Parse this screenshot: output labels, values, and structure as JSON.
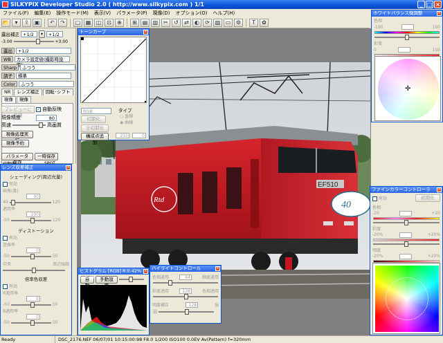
{
  "window": {
    "title": "SILKYPIX Developer Studio 2.0 ( http://www.silkypix.com )  1/1"
  },
  "menu": [
    "ファイル(F)",
    "編集(E)",
    "操作モード(M)",
    "表示(V)",
    "パラメータ(P)",
    "現像(D)",
    "オプション(O)",
    "ヘルプ(H)"
  ],
  "left": {
    "exposure_label": "露出補正",
    "exposure_value": "+1/2",
    "exposure_value2": "+1/2",
    "range_min": "-3.00",
    "range_max": "+3.00",
    "exposure_sel_label": "露出",
    "exposure_sel": "+1/2",
    "wb_label": "WB",
    "wb_value": "カメラ設定値(撮影時設定)",
    "sharp_label": "Sharp",
    "sharp_value": "ふつう",
    "tone_label": "調子",
    "tone_value": "標準",
    "color_label": "Color",
    "color_value": "ふつう",
    "tab_nr": "NR",
    "tab_lens": "レンズ補正",
    "tab_rotate": "回転･シフト",
    "tab_develop": "現像",
    "tab_develop_sub": "現像",
    "preview_btn": "プレビューに反映",
    "auto_reflect": "自動反映",
    "precision_label": "現像精度",
    "precision_value": "80",
    "fast": "高速",
    "quality": "高画質",
    "develop_exec": "現像処理実行",
    "develop_reserve": "現像予約",
    "param_save": "パラメータ保存",
    "temp_save": "一時保存",
    "initial": "初期値",
    "spot": "SPOT"
  },
  "lens_panel": {
    "title": "レンズ収差補正",
    "shading": "シェーディング(周辺光量)",
    "enable": "有効",
    "corner_brightness": "画角(度)",
    "v40": "40",
    "v120": "120",
    "ratio": "適用率",
    "v100": "100",
    "vm50": "-50",
    "v50": "50",
    "distortion": "ディストーション",
    "dist_enable": "有効",
    "dist_amount": "歪曲率",
    "v0": "0",
    "center": "中央",
    "periphery": "周辺強調",
    "magnification": "倍率色収差",
    "mag_enable": "有効",
    "red_ratio": "R適用率",
    "blue_ratio": "B適用率"
  },
  "tone_curve": {
    "title": "トーンカーブ",
    "rgb": "RGB",
    "type_label": "タイプ",
    "type_linear": "直線",
    "type_curve": "曲線",
    "initialize": "初期化",
    "all_initialize": "全初期化",
    "add_point": "構成点追加",
    "v255": "255",
    "v0": "0"
  },
  "wb_panel": {
    "title": "ホワイトバランス微調整",
    "hue_label": "色相",
    "hue_min": "-180",
    "hue_max": "180",
    "sat_label": "彩度",
    "sat_min": "0",
    "sat_max": "100"
  },
  "fine_color": {
    "title": "ファインカラーコントローラ",
    "enable": "有効",
    "initialize": "初期化",
    "hue": "色相",
    "sat": "彩度",
    "light": "明度",
    "m20": "-20",
    "p20": "+20",
    "m20b": "-20%",
    "p20b": "+20%"
  },
  "histogram": {
    "title": "ヒストグラム [RGB]  R:0.42% G:0.38...",
    "auto": "自動",
    "manual": "手動設定"
  },
  "highlight": {
    "title": "ハイライトコントロール",
    "hue_label": "色相適用",
    "hue_val": "64",
    "hue_right": "輝度適用",
    "sat_label": "彩度適用",
    "sat_val": "128",
    "sat_right": "色相適用",
    "light_label": "明度補正",
    "light_val": "128",
    "light_right": "強",
    "weak": "弱"
  },
  "status": {
    "ready": "Ready",
    "info": "DSC_2176.NEF 06/07/01 10:15:00:98 F8.0 1/200 ISO100  0.0EV Av(Pattern) f=320mm"
  },
  "locomotive": {
    "number": "EF510"
  },
  "colors": {
    "titlebar": "#0a54d6",
    "loco_red": "#c41620",
    "panel_bg": "#ece9d8"
  }
}
